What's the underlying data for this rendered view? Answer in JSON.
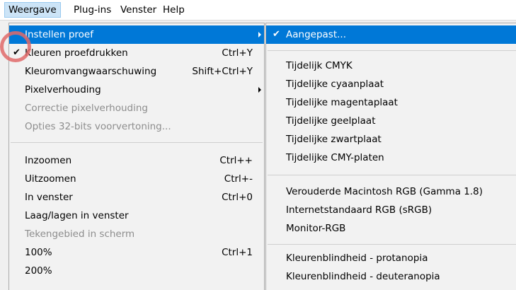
{
  "menubar": {
    "items": [
      "Weergave",
      "Plug-ins",
      "Venster",
      "Help"
    ]
  },
  "main_menu": {
    "items": [
      {
        "label": "Instellen proef",
        "shortcut": "",
        "submenu": true,
        "highlighted": true
      },
      {
        "label": "Kleuren proefdrukken",
        "shortcut": "Ctrl+Y",
        "checked": true
      },
      {
        "label": "Kleuromvangwaarschuwing",
        "shortcut": "Shift+Ctrl+Y"
      },
      {
        "label": "Pixelverhouding",
        "shortcut": "",
        "submenu": true
      },
      {
        "label": "Correctie pixelverhouding",
        "shortcut": "",
        "disabled": true
      },
      {
        "label": "Opties 32-bits voorvertoning...",
        "shortcut": "",
        "disabled": true
      },
      {
        "label": "Inzoomen",
        "shortcut": "Ctrl++"
      },
      {
        "label": "Uitzoomen",
        "shortcut": "Ctrl+-"
      },
      {
        "label": "In venster",
        "shortcut": "Ctrl+0"
      },
      {
        "label": "Laag/lagen in venster",
        "shortcut": ""
      },
      {
        "label": "Tekengebied in scherm",
        "shortcut": "",
        "disabled": true
      },
      {
        "label": "100%",
        "shortcut": "Ctrl+1"
      },
      {
        "label": "200%",
        "shortcut": ""
      }
    ]
  },
  "sub_menu": {
    "items": [
      {
        "label": "Aangepast...",
        "checked": true,
        "highlighted": true
      },
      {
        "label": "Tijdelijk CMYK"
      },
      {
        "label": "Tijdelijke cyaanplaat"
      },
      {
        "label": "Tijdelijke magentaplaat"
      },
      {
        "label": "Tijdelijke geelplaat"
      },
      {
        "label": "Tijdelijke zwartplaat"
      },
      {
        "label": "Tijdelijke CMY-platen"
      },
      {
        "label": "Verouderde Macintosh RGB (Gamma 1.8)"
      },
      {
        "label": "Internetstandaard RGB (sRGB)"
      },
      {
        "label": "Monitor-RGB"
      },
      {
        "label": "Kleurenblindheid - protanopia"
      },
      {
        "label": "Kleurenblindheid - deuteranopia"
      }
    ]
  },
  "check_glyph": "✔",
  "colors": {
    "highlight": "#0078d7",
    "marker": "#e06a6a"
  }
}
